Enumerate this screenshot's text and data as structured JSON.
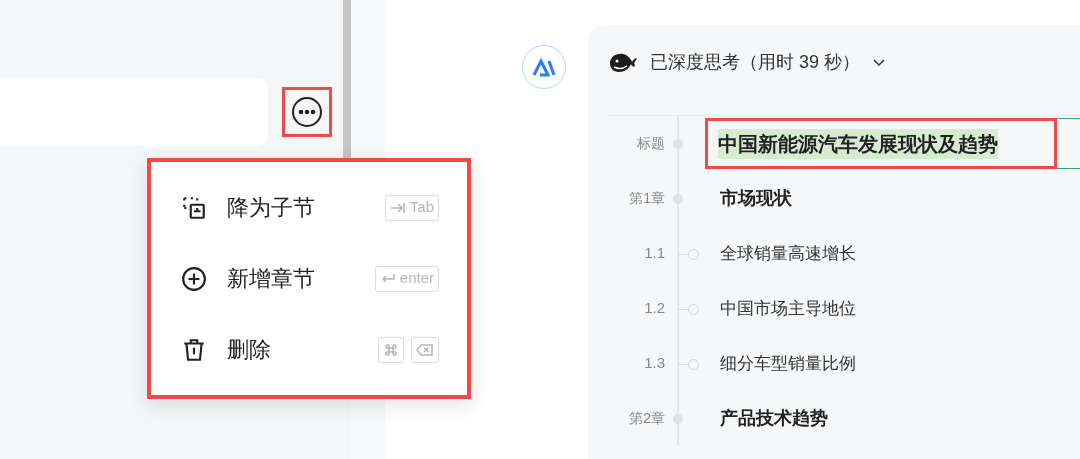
{
  "editor": {
    "more_button": {
      "annotated": true
    }
  },
  "menu": {
    "annotated": true,
    "items": [
      {
        "kind": "demote",
        "label": "降为子节",
        "keys": [
          {
            "kind": "tab",
            "text": "Tab"
          }
        ]
      },
      {
        "kind": "add",
        "label": "新增章节",
        "keys": [
          {
            "kind": "enter",
            "text": "enter"
          }
        ]
      },
      {
        "kind": "delete",
        "label": "删除",
        "keys": [
          {
            "kind": "command"
          },
          {
            "kind": "backspace"
          }
        ]
      }
    ]
  },
  "response": {
    "thinking": "已深度思考（用时 39 秒）",
    "expanded": false,
    "outline": {
      "title": {
        "label": "标题",
        "text": "中国新能源汽车发展现状及趋势",
        "annotated": true
      },
      "chapters": [
        {
          "label": "第1章",
          "text": "市场现状",
          "children": [
            {
              "label": "1.1",
              "text": "全球销量高速增长"
            },
            {
              "label": "1.2",
              "text": "中国市场主导地位"
            },
            {
              "label": "1.3",
              "text": "细分车型销量比例"
            }
          ]
        },
        {
          "label": "第2章",
          "text": "产品技术趋势"
        }
      ]
    }
  }
}
